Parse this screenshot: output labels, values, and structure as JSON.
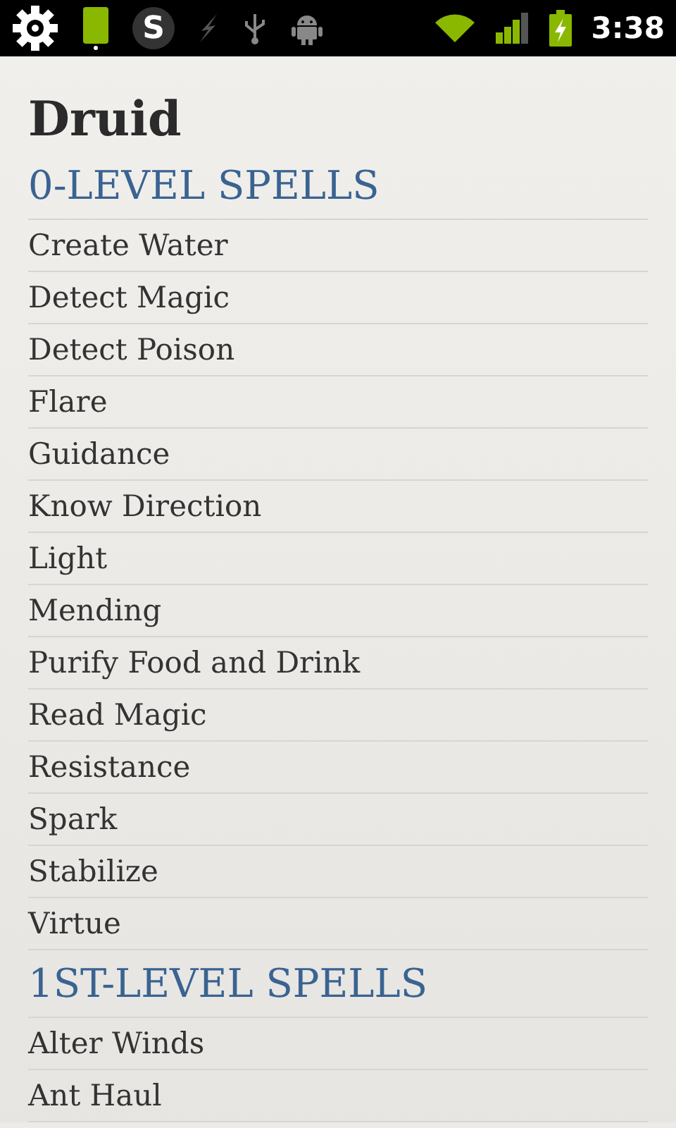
{
  "status_bar": {
    "app_letter": "S",
    "time": "3:38"
  },
  "title": "Druid",
  "sections": [
    {
      "heading": "0-LEVEL SPELLS",
      "spells": [
        "Create Water",
        "Detect Magic",
        "Detect Poison",
        "Flare",
        "Guidance",
        "Know Direction",
        "Light",
        "Mending",
        "Purify Food and Drink",
        "Read Magic",
        "Resistance",
        "Spark",
        "Stabilize",
        "Virtue"
      ]
    },
    {
      "heading": "1ST-LEVEL SPELLS",
      "spells": [
        "Alter Winds",
        "Ant Haul"
      ]
    }
  ]
}
